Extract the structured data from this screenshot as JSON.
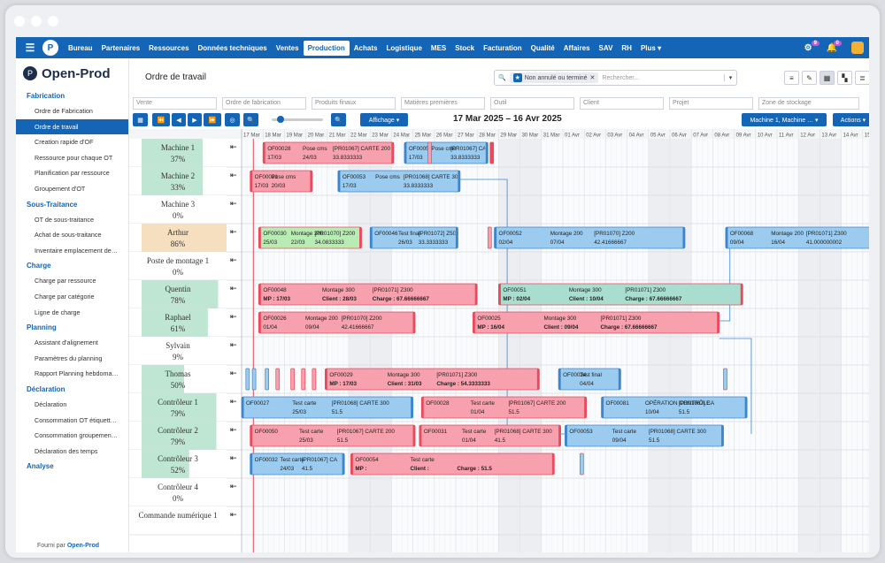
{
  "nav": {
    "items": [
      "Bureau",
      "Partenaires",
      "Ressources",
      "Données techniques",
      "Ventes",
      "Production",
      "Achats",
      "Logistique",
      "MES",
      "Stock",
      "Facturation",
      "Qualité",
      "Affaires",
      "SAV",
      "RH",
      "Plus ▾"
    ],
    "active": 5,
    "badge_settings": "9",
    "badge_bell": "0"
  },
  "brand": {
    "name": "Open-Prod"
  },
  "sidebar": [
    {
      "title": "Fabrication",
      "items": [
        "Ordre de Fabrication",
        "Ordre de travail",
        "Creation rapide d'OF",
        "Ressource pour chaque OT",
        "Planification par ressource",
        "Groupement d'OT"
      ]
    },
    {
      "title": "Sous-Traitance",
      "items": [
        "OT de sous-traitance",
        "Achat de sous-traitance",
        "Inventaire emplacement de…"
      ]
    },
    {
      "title": "Charge",
      "items": [
        "Charge par ressource",
        "Charge par catégorie",
        "Ligne de charge"
      ]
    },
    {
      "title": "Planning",
      "items": [
        "Assistant d'alignement",
        "Paramètres du planning",
        "Rapport Planning hebdoma…"
      ]
    },
    {
      "title": "Déclaration",
      "items": [
        "Déclaration",
        "Consommation OT étiquett…",
        "Consommation groupemen…",
        "Déclaration des temps"
      ]
    },
    {
      "title": "Analyse",
      "items": []
    }
  ],
  "sidebar_active": "Ordre de travail",
  "footer": {
    "prefix": "Fourni par",
    "brand": "Open-Prod"
  },
  "page": {
    "title": "Ordre de travail"
  },
  "search": {
    "filter_tag": "Non annulé ou terminé",
    "placeholder": "Rechercher..."
  },
  "filters": [
    "Vente",
    "Ordre de fabrication",
    "Produits finaux",
    "Matières premières",
    "Outil",
    "Client",
    "Projet",
    "Zone de stockage"
  ],
  "toolbar": {
    "affichage": "Affichage ▾",
    "range": "17 Mar 2025 – 16 Avr 2025",
    "resource_select": "Machine 1, Machine … ▾",
    "actions": "Actions ▾"
  },
  "gantt": {
    "dates": [
      "17 Mar",
      "18 Mar",
      "19 Mar",
      "20 Mar",
      "21 Mar",
      "22 Mar",
      "23 Mar",
      "24 Mar",
      "25 Mar",
      "26 Mar",
      "27 Mar",
      "28 Mar",
      "29 Mar",
      "30 Mar",
      "31 Mar",
      "01 Avr",
      "02 Avr",
      "03 Avr",
      "04 Avr",
      "05 Avr",
      "06 Avr",
      "07 Avr",
      "08 Avr",
      "09 Avr",
      "10 Avr",
      "11 Avr",
      "12 Avr",
      "13 Avr",
      "14 Avr",
      "15 Avr"
    ],
    "resources": [
      {
        "name": "Machine 1",
        "load": "37%",
        "color": "#bfe6d2",
        "fill": 0.72
      },
      {
        "name": "Machine 2",
        "load": "33%",
        "color": "#bfe6d2",
        "fill": 0.72
      },
      {
        "name": "Machine 3",
        "load": "0%",
        "color": "#ffffff",
        "fill": 0
      },
      {
        "name": "Arthur",
        "load": "86%",
        "color": "#f5dfbf",
        "fill": 1
      },
      {
        "name": "Poste de montage 1",
        "load": "0%",
        "color": "#ffffff",
        "fill": 0
      },
      {
        "name": "Quentin",
        "load": "78%",
        "color": "#bfe6d2",
        "fill": 0.9
      },
      {
        "name": "Raphael",
        "load": "61%",
        "color": "#bfe6d2",
        "fill": 0.78
      },
      {
        "name": "Sylvain",
        "load": "9%",
        "color": "#ffffff",
        "fill": 0.1
      },
      {
        "name": "Thomas",
        "load": "50%",
        "color": "#bfe6d2",
        "fill": 0.5
      },
      {
        "name": "Contrôleur 1",
        "load": "79%",
        "color": "#bfe6d2",
        "fill": 0.88
      },
      {
        "name": "Contrôleur 2",
        "load": "79%",
        "color": "#bfe6d2",
        "fill": 0.88
      },
      {
        "name": "Contrôleur 3",
        "load": "52%",
        "color": "#bfe6d2",
        "fill": 0.56
      },
      {
        "name": "Contrôleur 4",
        "load": "0%",
        "color": "#ffffff",
        "fill": 0
      },
      {
        "name": "Commande numérique 1",
        "load": "",
        "color": "#ffffff",
        "fill": 0
      }
    ],
    "bars": [
      {
        "row": 0,
        "start": 1.0,
        "end": 7.1,
        "c": "pink",
        "l1": [
          "OF00028",
          "Pose cms",
          "[PR01067] CARTE 200"
        ],
        "l2": [
          "17/03",
          "24/03",
          "33.8333333"
        ]
      },
      {
        "row": 0,
        "start": 7.6,
        "end": 11.5,
        "c": "blue",
        "l1": [
          "OF00050",
          "Pose cms",
          "[PR01067] CARTE"
        ],
        "l2": [
          "17/03",
          "",
          "33.8333333"
        ]
      },
      {
        "row": 1,
        "start": 0.4,
        "end": 3.3,
        "c": "pink",
        "l1": [
          "OF00031",
          "Pose cms",
          ""
        ],
        "l2": [
          "17/03",
          "20/03",
          ""
        ]
      },
      {
        "row": 1,
        "start": 4.5,
        "end": 10.2,
        "c": "blue",
        "l1": [
          "OF00053",
          "Pose cms",
          "[PR01068] CARTE 300"
        ],
        "l2": [
          "17/03",
          "",
          "33.8333333"
        ]
      },
      {
        "row": 3,
        "start": 0.8,
        "end": 5.6,
        "c": "green",
        "l1": [
          "OF00030",
          "Montage 200",
          "[PR01070] Z200"
        ],
        "l2": [
          "25/03",
          "22/03",
          "34.0833333"
        ]
      },
      {
        "row": 3,
        "start": 6.0,
        "end": 10.1,
        "c": "blue",
        "l1": [
          "OF00046",
          "Test final",
          "[PR01072] Z500"
        ],
        "l2": [
          "",
          "26/03",
          "33.3333333"
        ]
      },
      {
        "row": 3,
        "start": 11.8,
        "end": 20.7,
        "c": "blue",
        "l1": [
          "OF00052",
          "Montage 200",
          "[PR01070] Z200"
        ],
        "l2": [
          "02/04",
          "07/04",
          "42.41666667"
        ]
      },
      {
        "row": 3,
        "start": 22.6,
        "end": 29.7,
        "c": "blue",
        "l1": [
          "OF00068",
          "Montage 200",
          "[PR01071] Z300"
        ],
        "l2": [
          "09/04",
          "16/04",
          "41.000000002"
        ]
      },
      {
        "row": 5,
        "start": 0.8,
        "end": 11.0,
        "c": "pink",
        "l1": [
          "OF00048",
          "Montage 300",
          "[PR01071] Z300"
        ],
        "l2": [
          "MP : 17/03",
          "Client : 28/03",
          "Charge : 67.66666667"
        ]
      },
      {
        "row": 5,
        "start": 12.0,
        "end": 23.4,
        "c": "teal",
        "l1": [
          "OF00051",
          "Montage 300",
          "[PR01071] Z300"
        ],
        "l2": [
          "MP : 02/04",
          "Client : 10/04",
          "Charge : 67.66666667"
        ]
      },
      {
        "row": 6,
        "start": 0.8,
        "end": 8.1,
        "c": "pink",
        "l1": [
          "OF00026",
          "Montage 200",
          "[PR01070] Z200"
        ],
        "l2": [
          "01/04",
          "09/04",
          "42.41666667"
        ]
      },
      {
        "row": 6,
        "start": 10.8,
        "end": 22.3,
        "c": "pink",
        "l1": [
          "OF00025",
          "Montage 300",
          "[PR01071] Z300"
        ],
        "l2": [
          "MP : 16/04",
          "Client : 09/04",
          "Charge : 67.66666667"
        ]
      },
      {
        "row": 8,
        "start": 3.9,
        "end": 13.9,
        "c": "pink",
        "l1": [
          "OF00029",
          "Montage 300",
          "[PR01071] Z300"
        ],
        "l2": [
          "MP : 17/03",
          "Client : 31/03",
          "Charge : 54.3333333"
        ]
      },
      {
        "row": 8,
        "start": 14.8,
        "end": 17.7,
        "c": "blue",
        "l1": [
          "OF00024",
          "Test final",
          ""
        ],
        "l2": [
          "",
          "04/04",
          ""
        ]
      },
      {
        "row": 9,
        "start": 0.0,
        "end": 8.0,
        "c": "blue",
        "l1": [
          "OF00027",
          "Test carte",
          "[PR01068] CARTE 300"
        ],
        "l2": [
          "",
          "25/03",
          "51.5"
        ]
      },
      {
        "row": 9,
        "start": 8.4,
        "end": 16.1,
        "c": "pink",
        "l1": [
          "OF00028",
          "Test carte",
          "[PR01067] CARTE 200"
        ],
        "l2": [
          "",
          "01/04",
          "51.5"
        ]
      },
      {
        "row": 9,
        "start": 16.8,
        "end": 23.6,
        "c": "blue",
        "l1": [
          "OF00081",
          "OPÉRATION CONTRÔLE",
          "[PR01067] CA"
        ],
        "l2": [
          "",
          "10/04",
          "51.5"
        ]
      },
      {
        "row": 10,
        "start": 0.4,
        "end": 8.1,
        "c": "pink",
        "l1": [
          "OF00050",
          "Test carte",
          "[PR01067] CARTE 200"
        ],
        "l2": [
          "",
          "25/03",
          "51.5"
        ]
      },
      {
        "row": 10,
        "start": 8.3,
        "end": 14.9,
        "c": "pink",
        "l1": [
          "OF00031",
          "Test carte",
          "[PR01068] CARTE 300"
        ],
        "l2": [
          "",
          "01/04",
          "41.5"
        ]
      },
      {
        "row": 10,
        "start": 15.1,
        "end": 22.5,
        "c": "blue",
        "l1": [
          "OF00053",
          "Test carte",
          "[PR01068] CARTE 300"
        ],
        "l2": [
          "",
          "09/04",
          "51.5"
        ]
      },
      {
        "row": 11,
        "start": 0.4,
        "end": 4.8,
        "c": "blue",
        "l1": [
          "OF00032",
          "Test carte",
          "[PR01067] CA"
        ],
        "l2": [
          "",
          "24/03",
          "41.5"
        ]
      },
      {
        "row": 11,
        "start": 5.1,
        "end": 14.6,
        "c": "pink",
        "l1": [
          "OF00054",
          "Test carte",
          ""
        ],
        "l2": [
          "MP :",
          "Client :",
          "Charge : 51.5"
        ]
      }
    ]
  }
}
